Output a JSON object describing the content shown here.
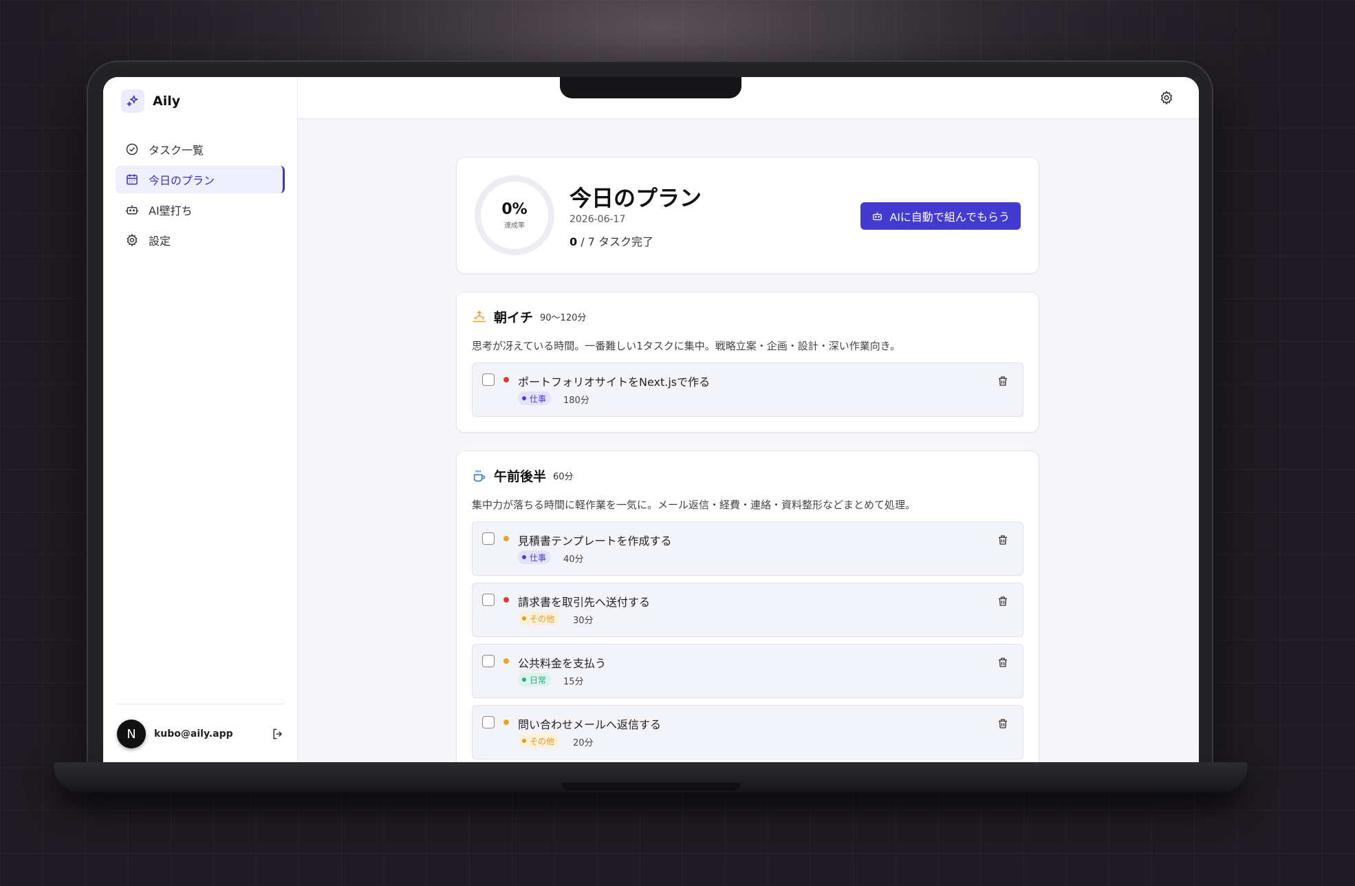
{
  "app": {
    "name": "Aily"
  },
  "sidebar": {
    "items": [
      {
        "label": "タスク一覧",
        "icon": "check-circle-icon",
        "active": false
      },
      {
        "label": "今日のプラン",
        "icon": "calendar-icon",
        "active": true
      },
      {
        "label": "AI壁打ち",
        "icon": "robot-icon",
        "active": false
      },
      {
        "label": "設定",
        "icon": "gear-icon",
        "active": false
      }
    ],
    "user": {
      "initial": "N",
      "email": "kubo@aily.app"
    }
  },
  "summary": {
    "percent": "0%",
    "percent_label": "達成率",
    "title": "今日のプラン",
    "date": "2026-06-17",
    "done": "0",
    "count_rest": " / 7 タスク完了",
    "ai_button": "AIに自動で組んでもらう"
  },
  "blocks": [
    {
      "title": "朝イチ",
      "duration": "90〜120分",
      "icon": "sunrise-icon",
      "description": "思考が冴えている時間。一番難しい1タスクに集中。戦略立案・企画・設計・深い作業向き。",
      "tasks": [
        {
          "title": "ポートフォリオサイトをNext.jsで作る",
          "priority": "high",
          "tag": "仕事",
          "duration": "180分"
        }
      ]
    },
    {
      "title": "午前後半",
      "duration": "60分",
      "icon": "coffee-icon",
      "description": "集中力が落ちる時間に軽作業を一気に。メール返信・経費・連絡・資料整形などまとめて処理。",
      "tasks": [
        {
          "title": "見積書テンプレートを作成する",
          "priority": "medium",
          "tag": "仕事",
          "duration": "40分"
        },
        {
          "title": "請求書を取引先へ送付する",
          "priority": "high",
          "tag": "その他",
          "duration": "30分"
        },
        {
          "title": "公共料金を支払う",
          "priority": "medium",
          "tag": "日常",
          "duration": "15分"
        },
        {
          "title": "問い合わせメールへ返信する",
          "priority": "medium",
          "tag": "その他",
          "duration": "20分"
        }
      ]
    }
  ],
  "colors": {
    "accent": "#433bd0",
    "priority_high": "#e0393e",
    "priority_medium": "#f0a030",
    "tag_work_bg": "#e4e2fb",
    "tag_work_fg": "#4a3fd0",
    "tag_other_bg": "#fdf0d9",
    "tag_other_fg": "#e09a2a",
    "tag_daily_bg": "#dcf3ec",
    "tag_daily_fg": "#2aa886"
  }
}
